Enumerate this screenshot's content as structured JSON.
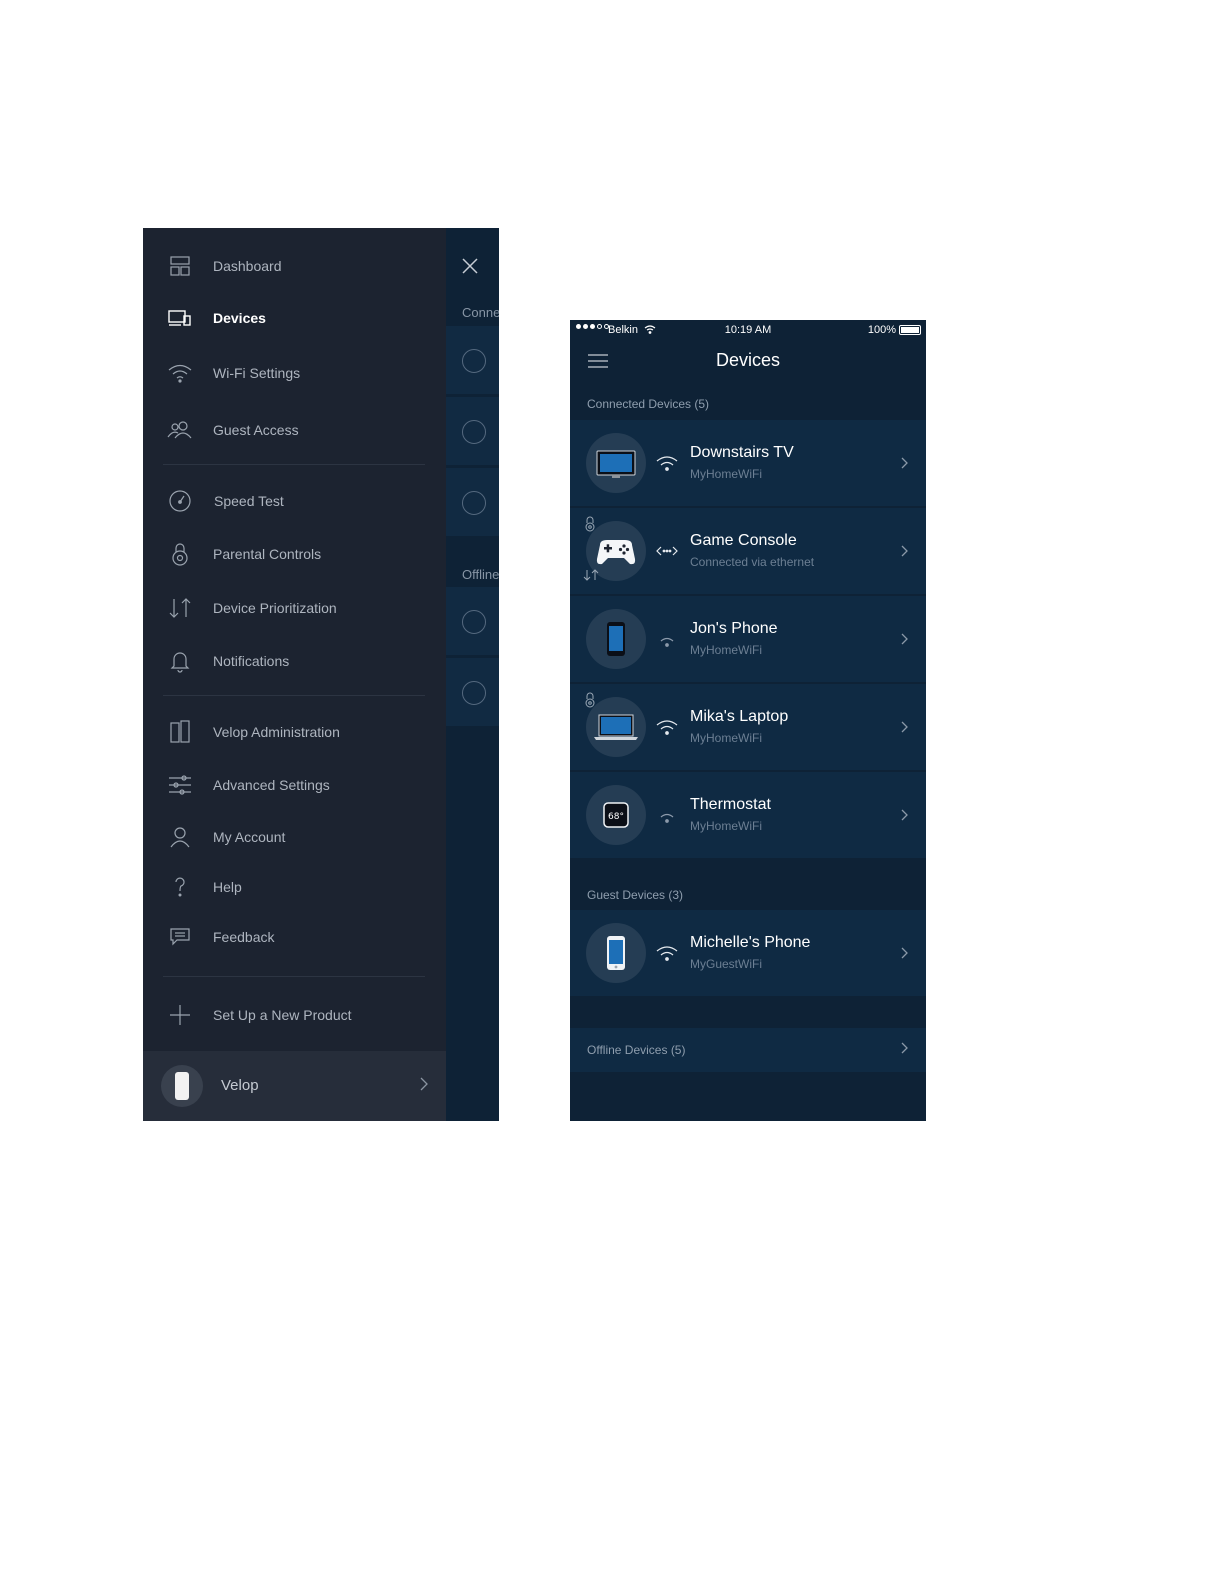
{
  "menu": {
    "items": [
      {
        "label": "Dashboard",
        "icon": "dashboard-icon"
      },
      {
        "label": "Devices",
        "icon": "devices-icon",
        "active": true
      },
      {
        "label": "Wi-Fi Settings",
        "icon": "wifi-icon"
      },
      {
        "label": "Guest Access",
        "icon": "guest-access-icon"
      },
      {
        "label": "Speed Test",
        "icon": "speedometer-icon"
      },
      {
        "label": "Parental Controls",
        "icon": "lock-icon"
      },
      {
        "label": "Device Prioritization",
        "icon": "priority-arrows-icon"
      },
      {
        "label": "Notifications",
        "icon": "bell-icon"
      },
      {
        "label": "Velop Administration",
        "icon": "velop-nodes-icon"
      },
      {
        "label": "Advanced Settings",
        "icon": "sliders-icon"
      },
      {
        "label": "My Account",
        "icon": "user-icon"
      },
      {
        "label": "Help",
        "icon": "question-icon"
      },
      {
        "label": "Feedback",
        "icon": "feedback-icon"
      },
      {
        "label": "Set Up a New Product",
        "icon": "plus-icon"
      }
    ],
    "footer": {
      "label": "Velop"
    }
  },
  "peek": {
    "connected_header": "Conne",
    "offline_header": "Offline"
  },
  "status_bar": {
    "carrier": "Belkin",
    "time": "10:19 AM",
    "battery": "100%"
  },
  "phone": {
    "title": "Devices",
    "connected_header": "Connected Devices (5)",
    "connected": [
      {
        "name": "Downstairs TV",
        "network": "MyHomeWiFi",
        "icon": "tv-icon",
        "connection": "wifi"
      },
      {
        "name": "Game Console",
        "network": "Connected via ethernet",
        "icon": "gamepad-icon",
        "connection": "ethernet"
      },
      {
        "name": "Jon's Phone",
        "network": "MyHomeWiFi",
        "icon": "phone-icon",
        "connection": "wifi"
      },
      {
        "name": "Mika's Laptop",
        "network": "MyHomeWiFi",
        "icon": "laptop-icon",
        "connection": "wifi"
      },
      {
        "name": "Thermostat",
        "network": "MyHomeWiFi",
        "icon": "thermostat-icon",
        "connection": "wifi",
        "display": "68°"
      }
    ],
    "guest_header": "Guest Devices (3)",
    "guest": [
      {
        "name": "Michelle's Phone",
        "network": "MyGuestWiFi",
        "icon": "phone-icon",
        "connection": "wifi"
      }
    ],
    "offline_label": "Offline Devices (5)"
  },
  "colors": {
    "drawer_bg": "#1c2330",
    "screen_bg": "#0e2236",
    "row_bg": "#0f2a43",
    "avatar_bg": "#253d54"
  }
}
